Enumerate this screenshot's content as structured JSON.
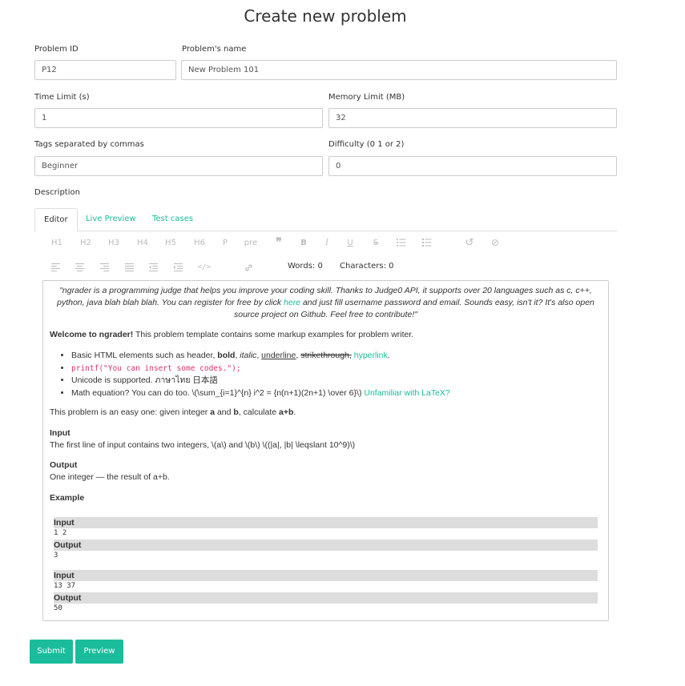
{
  "page": {
    "title": "Create new problem"
  },
  "form": {
    "problem_id": {
      "label": "Problem ID",
      "value": "P12"
    },
    "problem_name": {
      "label": "Problem's name",
      "value": "New Problem 101"
    },
    "time_limit": {
      "label": "Time Limit (s)",
      "value": "1"
    },
    "memory_limit": {
      "label": "Memory Limit (MB)",
      "value": "32"
    },
    "tags": {
      "label": "Tags separated by commas",
      "value": "Beginner"
    },
    "difficulty": {
      "label": "Difficulty (0 1 or 2)",
      "value": "0"
    },
    "description_label": "Description"
  },
  "tabs": [
    "Editor",
    "Live Preview",
    "Test cases"
  ],
  "toolbar": {
    "headings": [
      "H1",
      "H2",
      "H3",
      "H4",
      "H5",
      "H6",
      "P",
      "pre"
    ],
    "words": "Words: 0",
    "characters": "Characters: 0"
  },
  "editor": {
    "quote_before": "\"ngrader is a programming judge that helps you improve your coding skill. Thanks to Judge0 API, it supports over 20 languages such as c, c++, python, java blah blah blah. You can register for free by click ",
    "quote_link": "here",
    "quote_after": " and just fill username password and email. Sounds easy, isn't it? It's also open source project on Github. Feel free to contribute!\"",
    "welcome_bold": "Welcome to ngrader!",
    "welcome_rest": " This problem template contains some markup examples for problem writer.",
    "item1_prefix": "Basic HTML elements such as header, ",
    "item1_bold": "bold",
    "item1_italic": "italic",
    "item1_underline": "underline",
    "item1_strike": "strikethrough,",
    "item1_link": "hyperlink",
    "item2_code": "printf(\"You can insert some codes.\");",
    "item3": "Unicode is supported. ภาษาไทย 日本語",
    "item4_text": "Math equation? You can do too. \\(\\sum_{i=1}^{n} i^2 = {n(n+1)(2n+1) \\over 6}\\) ",
    "item4_link": "Unfamiliar with LaTeX?",
    "task_before": "This problem is an easy one: given integer ",
    "task_a": "a",
    "task_and": " and ",
    "task_b": "b",
    "task_mid": ", calculate ",
    "task_sum": "a+b",
    "input_heading": "Input",
    "input_text": "The first line of input contains two integers, \\(a\\) and \\(b\\) \\((|a|, |b| \\leqslant 10^9)\\)",
    "output_heading": "Output",
    "output_text": "One integer — the result of a+b.",
    "example_heading": "Example",
    "examples": [
      {
        "in_label": "Input",
        "in_value": "1 2",
        "out_label": "Output",
        "out_value": "3"
      },
      {
        "in_label": "Input",
        "in_value": "13 37",
        "out_label": "Output",
        "out_value": "50"
      }
    ]
  },
  "buttons": {
    "submit": "Submit",
    "preview": "Preview"
  },
  "colors": {
    "accent": "#1abc9c"
  }
}
